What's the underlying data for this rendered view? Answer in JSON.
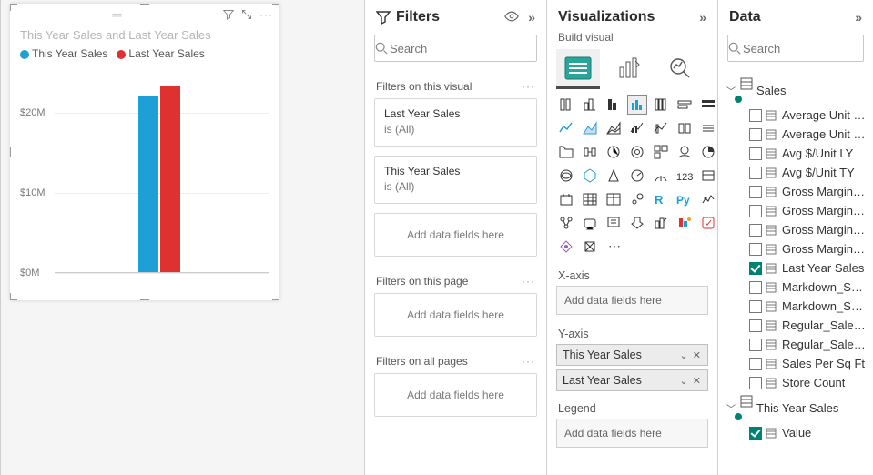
{
  "chart_data": {
    "type": "bar",
    "title": "This Year Sales and Last Year Sales",
    "ylabel": "",
    "yticks": [
      "$0M",
      "$10M",
      "$20M"
    ],
    "ylim": [
      0,
      25000000
    ],
    "series": [
      {
        "name": "This Year Sales",
        "value": 22000000,
        "color": "#1E9FD6"
      },
      {
        "name": "Last Year Sales",
        "value": 23200000,
        "color": "#E03131"
      }
    ]
  },
  "filters": {
    "title": "Filters",
    "search_placeholder": "Search",
    "on_visual_label": "Filters on this visual",
    "on_page_label": "Filters on this page",
    "on_all_label": "Filters on all pages",
    "drop_label": "Add data fields here",
    "cards": [
      {
        "name": "Last Year Sales",
        "status": "is (All)"
      },
      {
        "name": "This Year Sales",
        "status": "is (All)"
      }
    ]
  },
  "viz": {
    "title": "Visualizations",
    "subtitle": "Build visual",
    "wells": {
      "xaxis": {
        "label": "X-axis",
        "placeholder": "Add data fields here"
      },
      "yaxis": {
        "label": "Y-axis",
        "fields": [
          "This Year Sales",
          "Last Year Sales"
        ]
      },
      "legend": {
        "label": "Legend",
        "placeholder": "Add data fields here"
      }
    }
  },
  "data": {
    "title": "Data",
    "search_placeholder": "Search",
    "tables": [
      {
        "name": "Sales",
        "expanded": true,
        "fields": [
          {
            "name": "Average Unit P...",
            "checked": false
          },
          {
            "name": "Average Unit P...",
            "checked": false
          },
          {
            "name": "Avg $/Unit LY",
            "checked": false
          },
          {
            "name": "Avg $/Unit TY",
            "checked": false
          },
          {
            "name": "Gross Margin L...",
            "checked": false
          },
          {
            "name": "Gross Margin L...",
            "checked": false
          },
          {
            "name": "Gross Margin T...",
            "checked": false
          },
          {
            "name": "Gross Margin T...",
            "checked": false
          },
          {
            "name": "Last Year Sales",
            "checked": true
          },
          {
            "name": "Markdown_Sal...",
            "checked": false
          },
          {
            "name": "Markdown_Sal...",
            "checked": false
          },
          {
            "name": "Regular_Sales_...",
            "checked": false
          },
          {
            "name": "Regular_Sales_...",
            "checked": false
          },
          {
            "name": "Sales Per Sq Ft",
            "checked": false
          },
          {
            "name": "Store Count",
            "checked": false
          }
        ]
      },
      {
        "name": "This Year Sales",
        "expanded": true,
        "fields": [
          {
            "name": "Value",
            "checked": true
          }
        ]
      }
    ]
  }
}
